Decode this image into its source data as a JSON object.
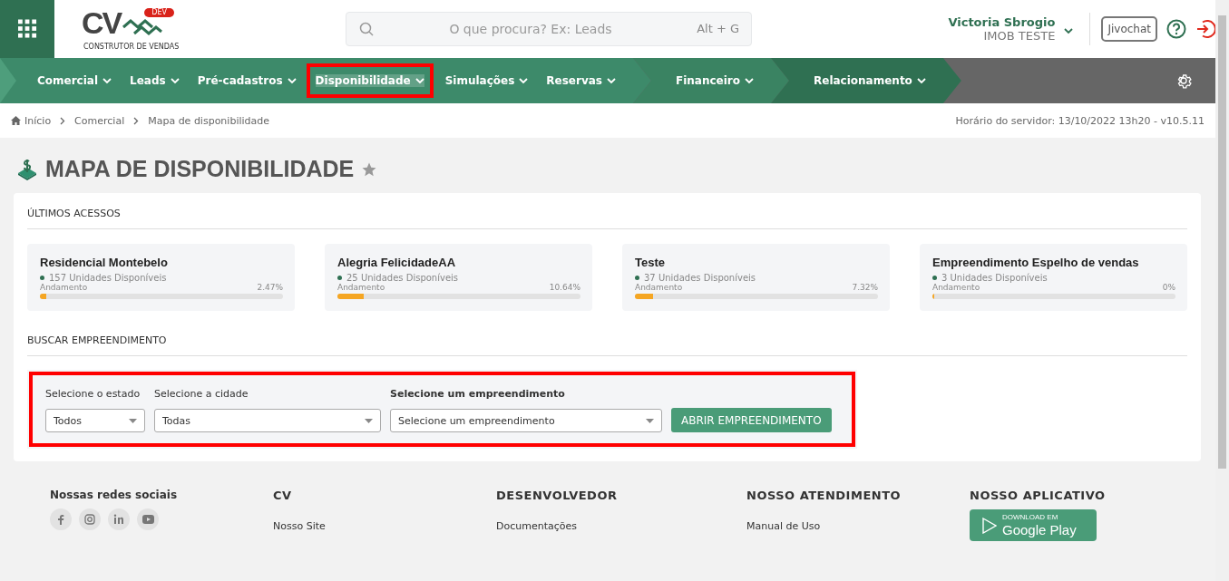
{
  "header": {
    "logo": {
      "letters": "CV",
      "badge": "DEV",
      "tagline": "CONSTRUTOR DE VENDAS"
    },
    "search": {
      "placeholder": "O que procura? Ex: Leads",
      "shortcut": "Alt + G"
    },
    "user": {
      "name": "Victoria Sbrogio",
      "company": "IMOB TESTE"
    },
    "chat_button": "Jivochat"
  },
  "nav": {
    "segments": [
      {
        "items": [
          {
            "label": "Comercial",
            "selected": false,
            "highlighted": false
          },
          {
            "label": "Leads",
            "selected": false,
            "highlighted": false
          },
          {
            "label": "Pré-cadastros",
            "selected": false,
            "highlighted": false
          },
          {
            "label": "Disponibilidade",
            "selected": true,
            "highlighted": true
          },
          {
            "label": "Simulações",
            "selected": false,
            "highlighted": false
          },
          {
            "label": "Reservas",
            "selected": false,
            "highlighted": false
          }
        ]
      },
      {
        "items": [
          {
            "label": "Financeiro",
            "selected": false,
            "highlighted": false
          }
        ]
      },
      {
        "items": [
          {
            "label": "Relacionamento",
            "selected": false,
            "highlighted": false
          }
        ]
      }
    ]
  },
  "breadcrumb": {
    "items": [
      "Início",
      "Comercial",
      "Mapa de disponibilidade"
    ],
    "server_info": "Horário do servidor: 13/10/2022 13h20 - v10.5.11"
  },
  "page_title": "MAPA DE DISPONIBILIDADE",
  "recent": {
    "heading": "ÚLTIMOS ACESSOS",
    "cards": [
      {
        "name": "Residencial Montebelo",
        "units": "157 Unidades Disponíveis",
        "progress_label": "Andamento",
        "percent": "2.47%",
        "level": 0.0247
      },
      {
        "name": "Alegria FelicidadeAA",
        "units": "25 Unidades Disponíveis",
        "progress_label": "Andamento",
        "percent": "10.64%",
        "level": 0.1064
      },
      {
        "name": "Teste",
        "units": "37 Unidades Disponíveis",
        "progress_label": "Andamento",
        "percent": "7.32%",
        "level": 0.0732
      },
      {
        "name": "Empreendimento Espelho de vendas",
        "units": "3 Unidades Disponíveis",
        "progress_label": "Andamento",
        "percent": "0%",
        "level": 0
      }
    ]
  },
  "search_section": {
    "heading": "BUSCAR EMPREENDIMENTO",
    "highlighted": true,
    "fields": [
      {
        "label": "Selecione o estado",
        "value": "Todos",
        "bold": false
      },
      {
        "label": "Selecione a cidade",
        "value": "Todas",
        "bold": false
      },
      {
        "label": "Selecione um empreendimento",
        "value": "Selecione um empreendimento",
        "bold": true
      }
    ],
    "button": "ABRIR EMPREENDIMENTO"
  },
  "footer": {
    "social_heading": "Nossas redes sociais",
    "columns": [
      {
        "heading": "CV",
        "links": [
          "Nosso Site"
        ]
      },
      {
        "heading": "DESENVOLVEDOR",
        "links": [
          "Documentações"
        ]
      },
      {
        "heading": "NOSSO ATENDIMENTO",
        "links": [
          "Manual de Uso"
        ]
      }
    ],
    "app": {
      "heading": "NOSSO APLICATIVO",
      "store_small": "DOWNLOAD EM",
      "store_name": "Google Play"
    }
  }
}
